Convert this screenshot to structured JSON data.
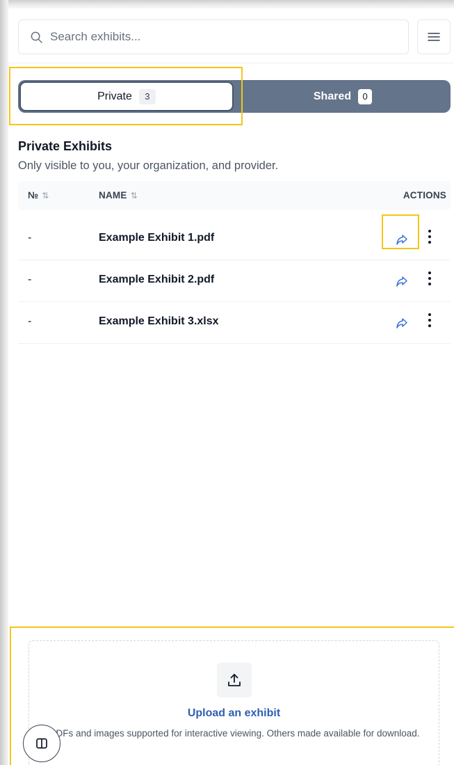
{
  "search": {
    "placeholder": "Search exhibits..."
  },
  "tabs": [
    {
      "label": "Private",
      "count": "3",
      "active": true
    },
    {
      "label": "Shared",
      "count": "0",
      "active": false
    }
  ],
  "section": {
    "title": "Private Exhibits",
    "subtitle": "Only visible to you, your organization, and provider."
  },
  "table": {
    "columns": {
      "number": "№",
      "name": "NAME",
      "actions": "ACTIONS"
    },
    "rows": [
      {
        "number": "-",
        "name": "Example Exhibit 1.pdf"
      },
      {
        "number": "-",
        "name": "Example Exhibit 2.pdf"
      },
      {
        "number": "-",
        "name": "Example Exhibit 3.xlsx"
      }
    ]
  },
  "upload": {
    "title": "Upload an exhibit",
    "description": "PDFs and images supported for interactive viewing. Others made available for download."
  },
  "icons": {
    "search": "search-icon",
    "menu": "hamburger-menu-icon",
    "sort": "sort-arrows-icon",
    "share": "share-arrow-icon",
    "more": "more-vertical-icon",
    "upload": "upload-icon",
    "sidebar": "sidebar-panel-icon"
  },
  "colors": {
    "tab_track": "#64748b",
    "share_icon": "#3b6fd8",
    "upload_title": "#2f5fb3",
    "highlight": "#f5c518"
  }
}
